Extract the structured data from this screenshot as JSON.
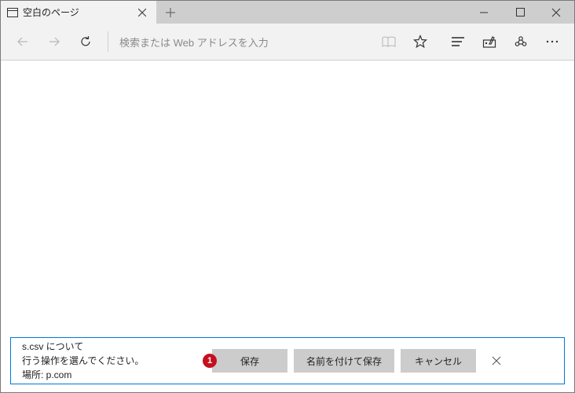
{
  "tab": {
    "title": "空白のページ"
  },
  "address": {
    "placeholder": "検索または Web アドレスを入力"
  },
  "download": {
    "line1": "s.csv について",
    "line2": "行う操作を選んでください。",
    "line3": "場所: p.com",
    "badge": "1",
    "save": "保存",
    "saveAs": "名前を付けて保存",
    "cancel": "キャンセル"
  }
}
